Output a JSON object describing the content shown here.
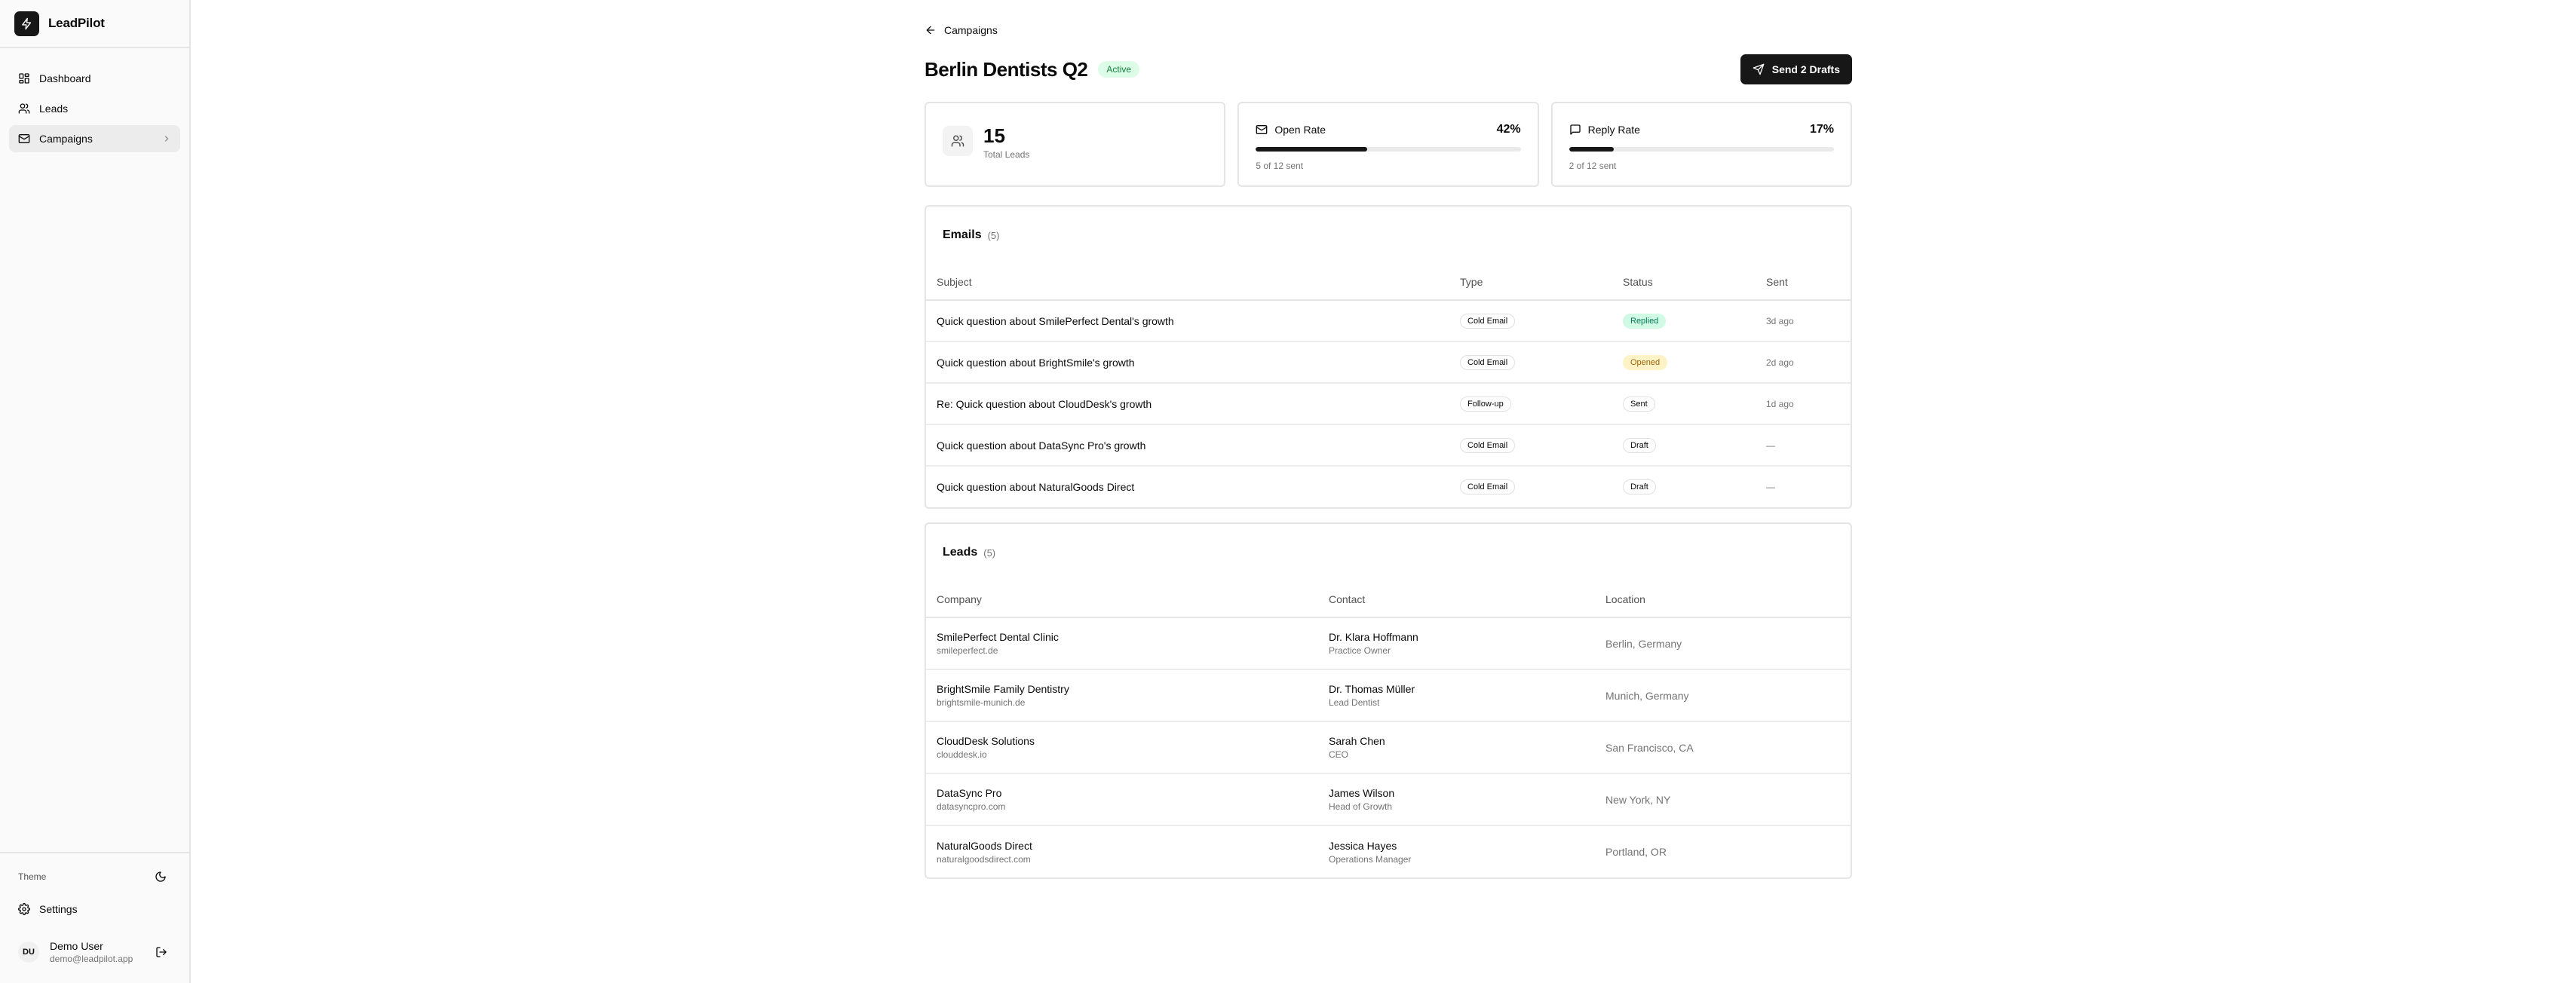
{
  "app": {
    "name": "LeadPilot"
  },
  "sidebar": {
    "items": [
      {
        "label": "Dashboard",
        "icon": "dashboard-icon"
      },
      {
        "label": "Leads",
        "icon": "users-icon"
      },
      {
        "label": "Campaigns",
        "icon": "mail-icon",
        "active": true
      }
    ],
    "theme_label": "Theme",
    "settings_label": "Settings",
    "user": {
      "initials": "DU",
      "name": "Demo User",
      "email": "demo@leadpilot.app"
    }
  },
  "header": {
    "back_label": "Campaigns",
    "title": "Berlin Dentists Q2",
    "status": "Active",
    "send_button": "Send 2 Drafts"
  },
  "stats": {
    "total_leads": {
      "value": "15",
      "label": "Total Leads"
    },
    "open_rate": {
      "label": "Open Rate",
      "value": "42%",
      "fraction": 0.42,
      "sub": "5 of 12 sent"
    },
    "reply_rate": {
      "label": "Reply Rate",
      "value": "17%",
      "fraction": 0.17,
      "sub": "2 of 12 sent"
    }
  },
  "emails": {
    "title": "Emails",
    "count": "(5)",
    "columns": [
      "Subject",
      "Type",
      "Status",
      "Sent"
    ],
    "rows": [
      {
        "subject": "Quick question about SmilePerfect Dental's growth",
        "type": "Cold Email",
        "status": "Replied",
        "sent": "3d ago"
      },
      {
        "subject": "Quick question about BrightSmile's growth",
        "type": "Cold Email",
        "status": "Opened",
        "sent": "2d ago"
      },
      {
        "subject": "Re: Quick question about CloudDesk's growth",
        "type": "Follow-up",
        "status": "Sent",
        "sent": "1d ago"
      },
      {
        "subject": "Quick question about DataSync Pro's growth",
        "type": "Cold Email",
        "status": "Draft",
        "sent": "—"
      },
      {
        "subject": "Quick question about NaturalGoods Direct",
        "type": "Cold Email",
        "status": "Draft",
        "sent": "—"
      }
    ]
  },
  "leads": {
    "title": "Leads",
    "count": "(5)",
    "columns": [
      "Company",
      "Contact",
      "Location"
    ],
    "rows": [
      {
        "company": "SmilePerfect Dental Clinic",
        "domain": "smileperfect.de",
        "contact": "Dr. Klara Hoffmann",
        "role": "Practice Owner",
        "location": "Berlin, Germany"
      },
      {
        "company": "BrightSmile Family Dentistry",
        "domain": "brightsmile-munich.de",
        "contact": "Dr. Thomas Müller",
        "role": "Lead Dentist",
        "location": "Munich, Germany"
      },
      {
        "company": "CloudDesk Solutions",
        "domain": "clouddesk.io",
        "contact": "Sarah Chen",
        "role": "CEO",
        "location": "San Francisco, CA"
      },
      {
        "company": "DataSync Pro",
        "domain": "datasyncpro.com",
        "contact": "James Wilson",
        "role": "Head of Growth",
        "location": "New York, NY"
      },
      {
        "company": "NaturalGoods Direct",
        "domain": "naturalgoodsdirect.com",
        "contact": "Jessica Hayes",
        "role": "Operations Manager",
        "location": "Portland, OR"
      }
    ]
  }
}
